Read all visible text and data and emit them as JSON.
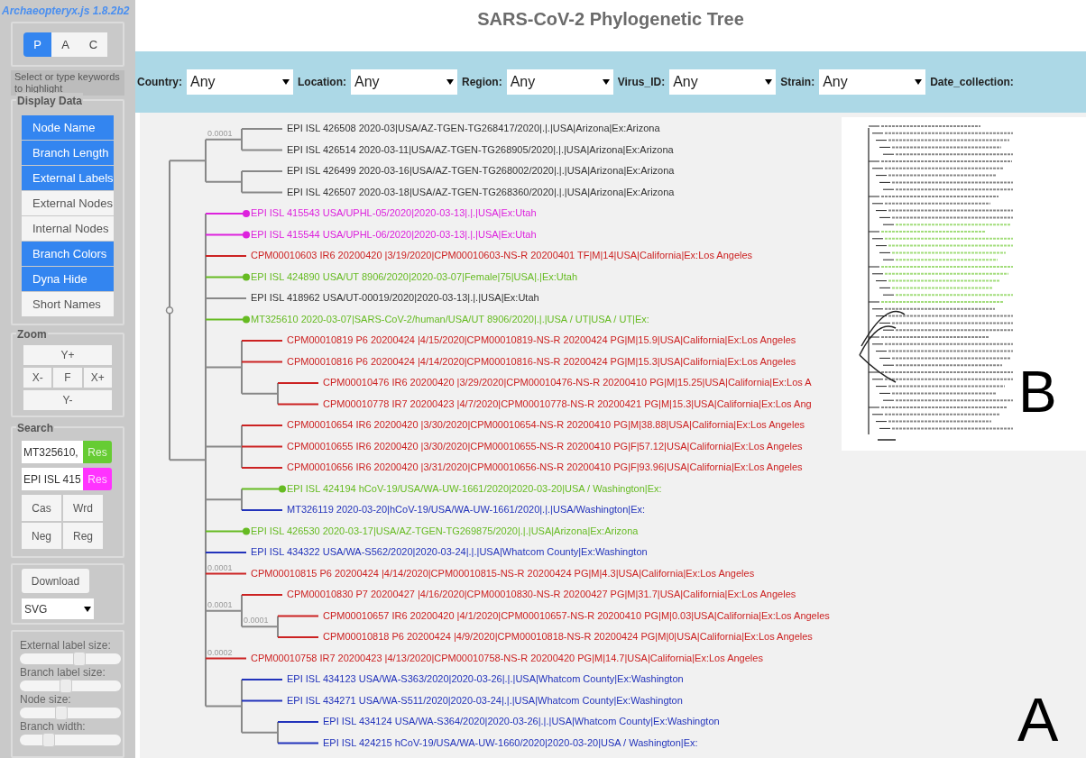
{
  "app_title": "Archaeopteryx.js 1.8.2b2",
  "page_title": "SARS-CoV-2 Phylogenetic Tree",
  "view_tabs": [
    {
      "label": "P",
      "selected": true
    },
    {
      "label": "A",
      "selected": false
    },
    {
      "label": "C",
      "selected": false
    }
  ],
  "search_hint": "Select or type keywords to highlight",
  "display_data": {
    "legend": "Display Data",
    "toggles": [
      {
        "label": "Node Name",
        "on": true
      },
      {
        "label": "Branch Length",
        "on": true
      },
      {
        "label": "External Labels",
        "on": true
      },
      {
        "label": "External Nodes",
        "on": false
      },
      {
        "label": "Internal Nodes",
        "on": false
      },
      {
        "label": "Branch Colors",
        "on": true
      },
      {
        "label": "Dyna Hide",
        "on": true
      },
      {
        "label": "Short Names",
        "on": false
      }
    ]
  },
  "zoom": {
    "legend": "Zoom",
    "buttons": [
      "Y+",
      "X-",
      "F",
      "X+",
      "Y-"
    ]
  },
  "search": {
    "legend": "Search",
    "queries": [
      {
        "value": "MT325610,",
        "button": "Res",
        "color": "#66cc33"
      },
      {
        "value": "EPI ISL 415",
        "button": "Res",
        "color": "#ff33ff"
      }
    ],
    "options": [
      "Cas",
      "Wrd",
      "Neg",
      "Reg"
    ]
  },
  "download": {
    "button": "Download",
    "format": "SVG"
  },
  "sliders": [
    {
      "label": "External label size:",
      "level": 0.6
    },
    {
      "label": "Branch label size:",
      "level": 0.45
    },
    {
      "label": "Node size:",
      "level": 0.4
    },
    {
      "label": "Branch width:",
      "level": 0.25
    }
  ],
  "filters": [
    {
      "label": "Country:",
      "value": "Any"
    },
    {
      "label": "Location:",
      "value": "Any"
    },
    {
      "label": "Region:",
      "value": "Any"
    },
    {
      "label": "Virus_ID:",
      "value": "Any"
    },
    {
      "label": "Strain:",
      "value": "Any"
    },
    {
      "label": "Date_collection:"
    }
  ],
  "tree": {
    "children": [
      {
        "children": [
          {
            "branch_label": "0.0001",
            "children": [
              {
                "label": "EPI ISL 426508 2020-03|USA/AZ-TGEN-TG268417/2020|.|.|USA|Arizona|Ex:Arizona",
                "color": "#333333",
                "dot": false
              },
              {
                "label": "EPI ISL 426514 2020-03-11|USA/AZ-TGEN-TG268905/2020|.|.|USA|Arizona|Ex:Arizona",
                "color": "#333333",
                "dot": false
              }
            ]
          },
          {
            "children": [
              {
                "label": "EPI ISL 426499 2020-03-16|USA/AZ-TGEN-TG268002/2020|.|.|USA|Arizona|Ex:Arizona",
                "color": "#333333",
                "dot": false
              },
              {
                "label": "EPI ISL 426507 2020-03-18|USA/AZ-TGEN-TG268360/2020|.|.|USA|Arizona|Ex:Arizona",
                "color": "#333333",
                "dot": false
              }
            ]
          }
        ]
      },
      {
        "children": [
          {
            "label": "EPI ISL 415543 USA/UPHL-05/2020|2020-03-13|.|.|USA|Ex:Utah",
            "color": "#dd22dd",
            "dot": true
          },
          {
            "label": "EPI ISL 415544 USA/UPHL-06/2020|2020-03-13|.|.|USA|Ex:Utah",
            "color": "#dd22dd",
            "dot": true
          },
          {
            "label": "CPM00010603 IR6 20200420 |3/19/2020|CPM00010603-NS-R 20200401 TF|M|14|USA|California|Ex:Los Angeles",
            "color": "#cc2222",
            "dot": false
          },
          {
            "label": "EPI ISL 424890 USA/UT 8906/2020|2020-03-07|Female|75|USA|.|Ex:Utah",
            "color": "#66bb22",
            "dot": true
          },
          {
            "label": "EPI ISL 418962 USA/UT-00019/2020|2020-03-13|.|.|USA|Ex:Utah",
            "color": "#333333",
            "dot": false
          },
          {
            "label": "MT325610 2020-03-07|SARS-CoV-2/human/USA/UT 8906/2020|.|.|USA / UT|USA / UT|Ex:",
            "color": "#66bb22",
            "dot": true
          },
          {
            "children": [
              {
                "label": "CPM00010819 P6 20200424 |4/15/2020|CPM00010819-NS-R 20200424 PG|M|15.9|USA|California|Ex:Los Angeles",
                "color": "#cc2222",
                "dot": false
              },
              {
                "label": "CPM00010816 P6 20200424 |4/14/2020|CPM00010816-NS-R 20200424 PG|M|15.3|USA|California|Ex:Los Angeles",
                "color": "#cc2222",
                "dot": false
              },
              {
                "children": [
                  {
                    "label": "CPM00010476 IR6 20200420 |3/29/2020|CPM00010476-NS-R 20200410 PG|M|15.25|USA|California|Ex:Los A",
                    "color": "#cc2222",
                    "dot": false
                  },
                  {
                    "label": "CPM00010778 IR7 20200423 |4/7/2020|CPM00010778-NS-R 20200421 PG|M|15.3|USA|California|Ex:Los Ang",
                    "color": "#cc2222",
                    "dot": false
                  }
                ]
              }
            ]
          },
          {
            "children": [
              {
                "label": "CPM00010654 IR6 20200420 |3/30/2020|CPM00010654-NS-R 20200410 PG|M|38.88|USA|California|Ex:Los Angeles",
                "color": "#cc2222",
                "dot": false
              },
              {
                "label": "CPM00010655 IR6 20200420 |3/30/2020|CPM00010655-NS-R 20200410 PG|F|57.12|USA|California|Ex:Los Angeles",
                "color": "#cc2222",
                "dot": false
              },
              {
                "label": "CPM00010656 IR6 20200420 |3/31/2020|CPM00010656-NS-R 20200410 PG|F|93.96|USA|California|Ex:Los Angeles",
                "color": "#cc2222",
                "dot": false
              }
            ]
          },
          {
            "children": [
              {
                "label": "EPI ISL 424194 hCoV-19/USA/WA-UW-1661/2020|2020-03-20|USA / Washington|Ex:",
                "color": "#66bb22",
                "dot": true
              },
              {
                "label": "MT326119 2020-03-20|hCoV-19/USA/WA-UW-1661/2020|.|.|USA/Washington|Ex:",
                "color": "#2233bb",
                "dot": false
              }
            ]
          },
          {
            "label": "EPI ISL 426530 2020-03-17|USA/AZ-TGEN-TG269875/2020|.|.|USA|Arizona|Ex:Arizona",
            "color": "#66bb22",
            "dot": true
          },
          {
            "label": "EPI ISL 434322 USA/WA-S562/2020|2020-03-24|.|.|USA|Whatcom County|Ex:Washington",
            "color": "#2233bb",
            "dot": false
          },
          {
            "branch_label": "0.0001",
            "label": "CPM00010815 P6 20200424 |4/14/2020|CPM00010815-NS-R 20200424 PG|M|4.3|USA|California|Ex:Los Angeles",
            "color": "#cc2222",
            "dot": false
          },
          {
            "branch_label": "0.0001",
            "children": [
              {
                "label": "CPM00010830 P7 20200427 |4/16/2020|CPM00010830-NS-R 20200427 PG|M|31.7|USA|California|Ex:Los Angeles",
                "color": "#cc2222",
                "dot": false
              },
              {
                "branch_label": "0.0001",
                "children": [
                  {
                    "label": "CPM00010657 IR6 20200420 |4/1/2020|CPM00010657-NS-R 20200410 PG|M|0.03|USA|California|Ex:Los Angeles",
                    "color": "#cc2222",
                    "dot": false
                  },
                  {
                    "label": "CPM00010818 P6 20200424 |4/9/2020|CPM00010818-NS-R 20200424 PG|M|0|USA|California|Ex:Los Angeles",
                    "color": "#cc2222",
                    "dot": false
                  }
                ]
              }
            ]
          },
          {
            "branch_label": "0.0002",
            "label": "CPM00010758 IR7 20200423 |4/13/2020|CPM00010758-NS-R 20200420 PG|M|14.7|USA|California|Ex:Los Angeles",
            "color": "#cc2222",
            "dot": false
          },
          {
            "children": [
              {
                "label": "EPI ISL 434123 USA/WA-S363/2020|2020-03-26|.|.|USA|Whatcom County|Ex:Washington",
                "color": "#2233bb",
                "dot": false
              },
              {
                "label": "EPI ISL 434271 USA/WA-S511/2020|2020-03-24|.|.|USA|Whatcom County|Ex:Washington",
                "color": "#2233bb",
                "dot": false
              },
              {
                "children": [
                  {
                    "label": "EPI ISL 434124 USA/WA-S364/2020|2020-03-26|.|.|USA|Whatcom County|Ex:Washington",
                    "color": "#2233bb",
                    "dot": false
                  },
                  {
                    "label": "EPI ISL 424215 hCoV-19/USA/WA-UW-1660/2020|2020-03-20|USA / Washington|Ex:",
                    "color": "#2233bb",
                    "dot": false
                  }
                ]
              }
            ]
          }
        ]
      }
    ]
  },
  "inset": {
    "label": "B"
  },
  "panel_label": "A"
}
